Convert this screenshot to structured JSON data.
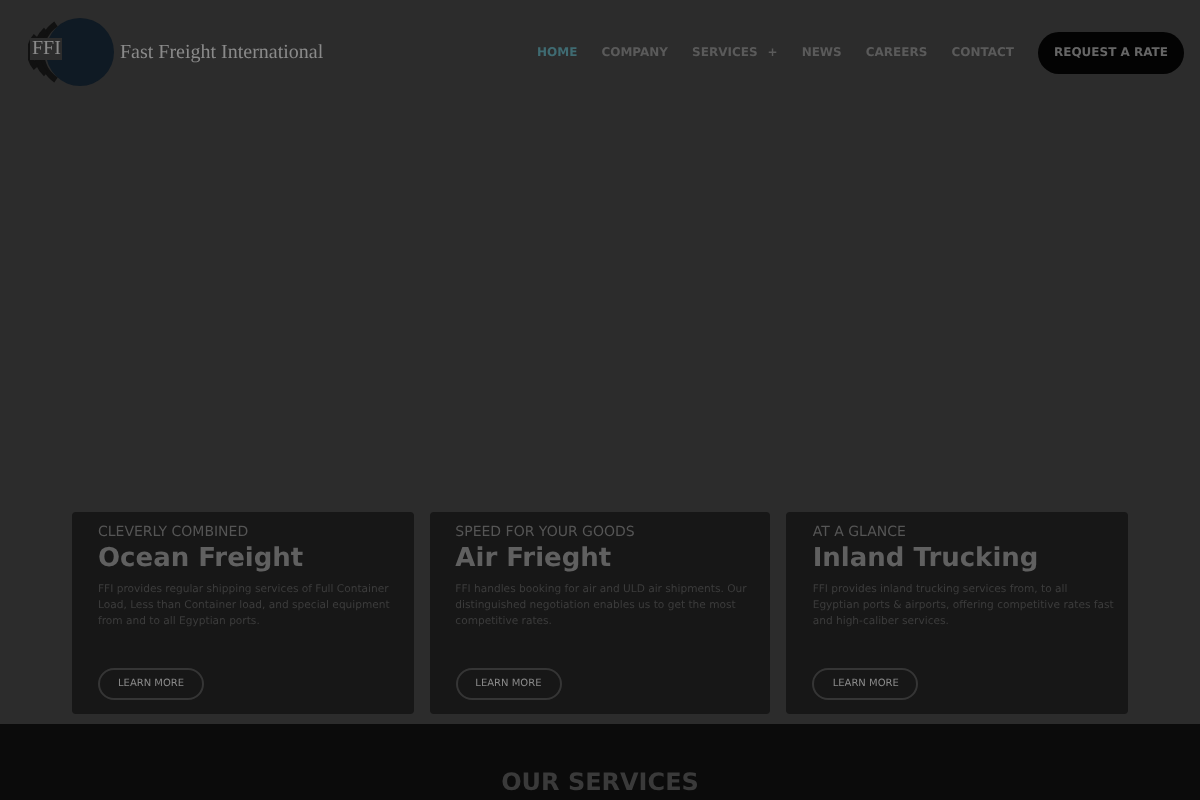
{
  "brand": {
    "logo_text": "FFI",
    "name": "Fast Freight International"
  },
  "nav": [
    {
      "label": "HOME",
      "selected": true
    },
    {
      "label": "COMPANY",
      "selected": false
    },
    {
      "label": "SERVICES",
      "selected": false,
      "submenu_icon": "+"
    },
    {
      "label": "NEWS",
      "selected": false
    },
    {
      "label": "CAREERS",
      "selected": false
    },
    {
      "label": "CONTACT",
      "selected": false
    }
  ],
  "cta": "REQUEST A RATE",
  "cards": [
    {
      "eyebrow": "CLEVERLY COMBINED",
      "title": "Ocean Freight",
      "text": "FFI provides regular shipping services of Full Container Load, Less than Container load, and special equipment from and to all Egyptian ports.",
      "button": "LEARN MORE"
    },
    {
      "eyebrow": "SPEED FOR YOUR GOODS",
      "title": "Air Frieght",
      "text": "FFI handles booking for air and ULD air shipments. Our distinguished negotiation enables us to get the most competitive rates.",
      "button": "LEARN MORE"
    },
    {
      "eyebrow": "AT A GLANCE",
      "title": "Inland Trucking",
      "text": "FFI provides inland trucking services from, to all Egyptian ports & airports, offering competitive rates fast and high-caliber services.",
      "button": "LEARN MORE"
    }
  ],
  "section_title": "OUR SERVICES"
}
